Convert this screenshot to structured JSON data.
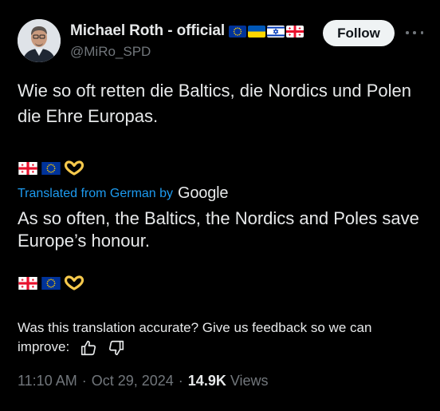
{
  "author": {
    "display_name": "Michael Roth - official",
    "handle": "@MiRo_SPD",
    "avatar_icon": "profile-photo",
    "name_flags": [
      "eu-flag-icon",
      "ukraine-flag-icon",
      "israel-flag-icon",
      "georgia-flag-icon"
    ]
  },
  "follow_label": "Follow",
  "more_icon": "more-horizontal-icon",
  "post": {
    "text": "Wie so oft retten die Baltics, die Nordics und Polen die Ehre Europas.",
    "emojis": [
      "georgia-flag-icon",
      "eu-flag-icon",
      "heart-hands-icon"
    ]
  },
  "translation": {
    "label": "Translated from German by",
    "provider": "Google",
    "text": "As so often, the Baltics, the Nordics and Poles save Europe’s honour.",
    "emojis": [
      "georgia-flag-icon",
      "eu-flag-icon",
      "heart-hands-icon"
    ]
  },
  "feedback": {
    "text": "Was this translation accurate? Give us feedback so we can improve:",
    "thumbs_up_icon": "thumbs-up-icon",
    "thumbs_down_icon": "thumbs-down-icon"
  },
  "meta": {
    "time": "11:10 AM",
    "separator": "·",
    "date": "Oct 29, 2024",
    "views_count": "14.9K",
    "views_label": "Views"
  },
  "colors": {
    "background": "#000000",
    "text": "#e7e9ea",
    "secondary": "#71767b",
    "link": "#1d9bf0",
    "follow_bg": "#eff3f4"
  }
}
